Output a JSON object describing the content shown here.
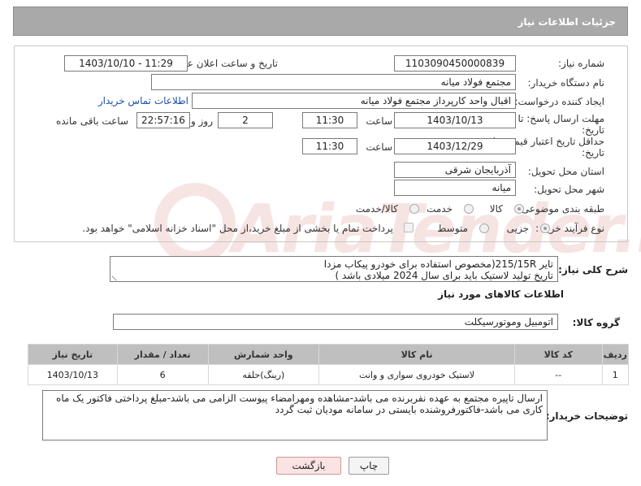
{
  "header": {
    "title": "جزئیات اطلاعات نیاز"
  },
  "form": {
    "need_number_label": "شماره نیاز:",
    "need_number": "1103090450000839",
    "announce_label": "تاریخ و ساعت اعلان عمومی:",
    "announce_value": "1403/10/10 - 11:29",
    "buyer_org_label": "نام دستگاه خریدار:",
    "buyer_org": "مجتمع فولاد میانه",
    "requester_label": "ایجاد کننده درخواست:",
    "requester": "اقبال واحد کارپرداز مجتمع فولاد میانه",
    "buyer_contact_link": "اطلاعات تماس خریدار",
    "reply_deadline_label_1": "مهلت ارسال پاسخ: تا",
    "reply_deadline_label_2": "تاریخ:",
    "reply_date": "1403/10/13",
    "time_label": "ساعت",
    "reply_time": "11:30",
    "days_value": "2",
    "days_label": "روز و",
    "remaining_time": "22:57:16",
    "remaining_label": "ساعت باقی مانده",
    "price_validity_label_1": "حداقل تاریخ اعتبار قیمت: تا",
    "price_validity_label_2": "تاریخ:",
    "price_validity_date": "1403/12/29",
    "price_validity_time": "11:30",
    "province_label": "استان محل تحویل:",
    "province": "آذربایجان شرقی",
    "city_label": "شهر محل تحویل:",
    "city": "میانه",
    "category_label": "طبقه بندی موضوعی:",
    "category_options": [
      "کالا",
      "خدمت",
      "کالا/خدمت"
    ],
    "purchase_type_label": "نوع فرآیند خرید :",
    "purchase_options": [
      "جزیی",
      "متوسط"
    ],
    "treasury_note": "پرداخت تمام یا بخشی از مبلغ خرید،از محل \"اسناد خزانه اسلامی\" خواهد بود."
  },
  "description": {
    "label": "شرح کلی نیاز:",
    "line1": "تایر 215/15R(مخصوص استفاده برای خودرو  پیکاب مزدا",
    "line2": "تاریخ تولید لاستیک باید برای سال 2024 میلادی باشد )"
  },
  "goods": {
    "section_title": "اطلاعات کالاهای مورد نیاز",
    "group_label": "گروه کالا:",
    "group_value": "اتومبیل وموتورسیکلت",
    "columns": [
      "ردیف",
      "کد کالا",
      "نام کالا",
      "واحد شمارش",
      "تعداد / مقدار",
      "تاریخ نیاز"
    ],
    "rows": [
      [
        "1",
        "--",
        "لاستیک خودروی سواری و وانت",
        "(رینگ)حلقه",
        "6",
        "1403/10/13"
      ]
    ]
  },
  "buyer_notes": {
    "label": "توضیحات خریدار:",
    "line1": "ارسال تاپیره مجتمع به عهده نفربرنده می باشد-مشاهده ومهرامضاء پیوست الزامی می باشد-مبلغ پرداختی فاکتور یک ماه",
    "line2": "کاری می باشد-فاکتورفروشنده بایستی در سامانه مودیان ثبت گردد"
  },
  "buttons": {
    "print": "چاپ",
    "back": "بازگشت"
  },
  "watermark": {
    "text": "AriaTender.neT"
  }
}
